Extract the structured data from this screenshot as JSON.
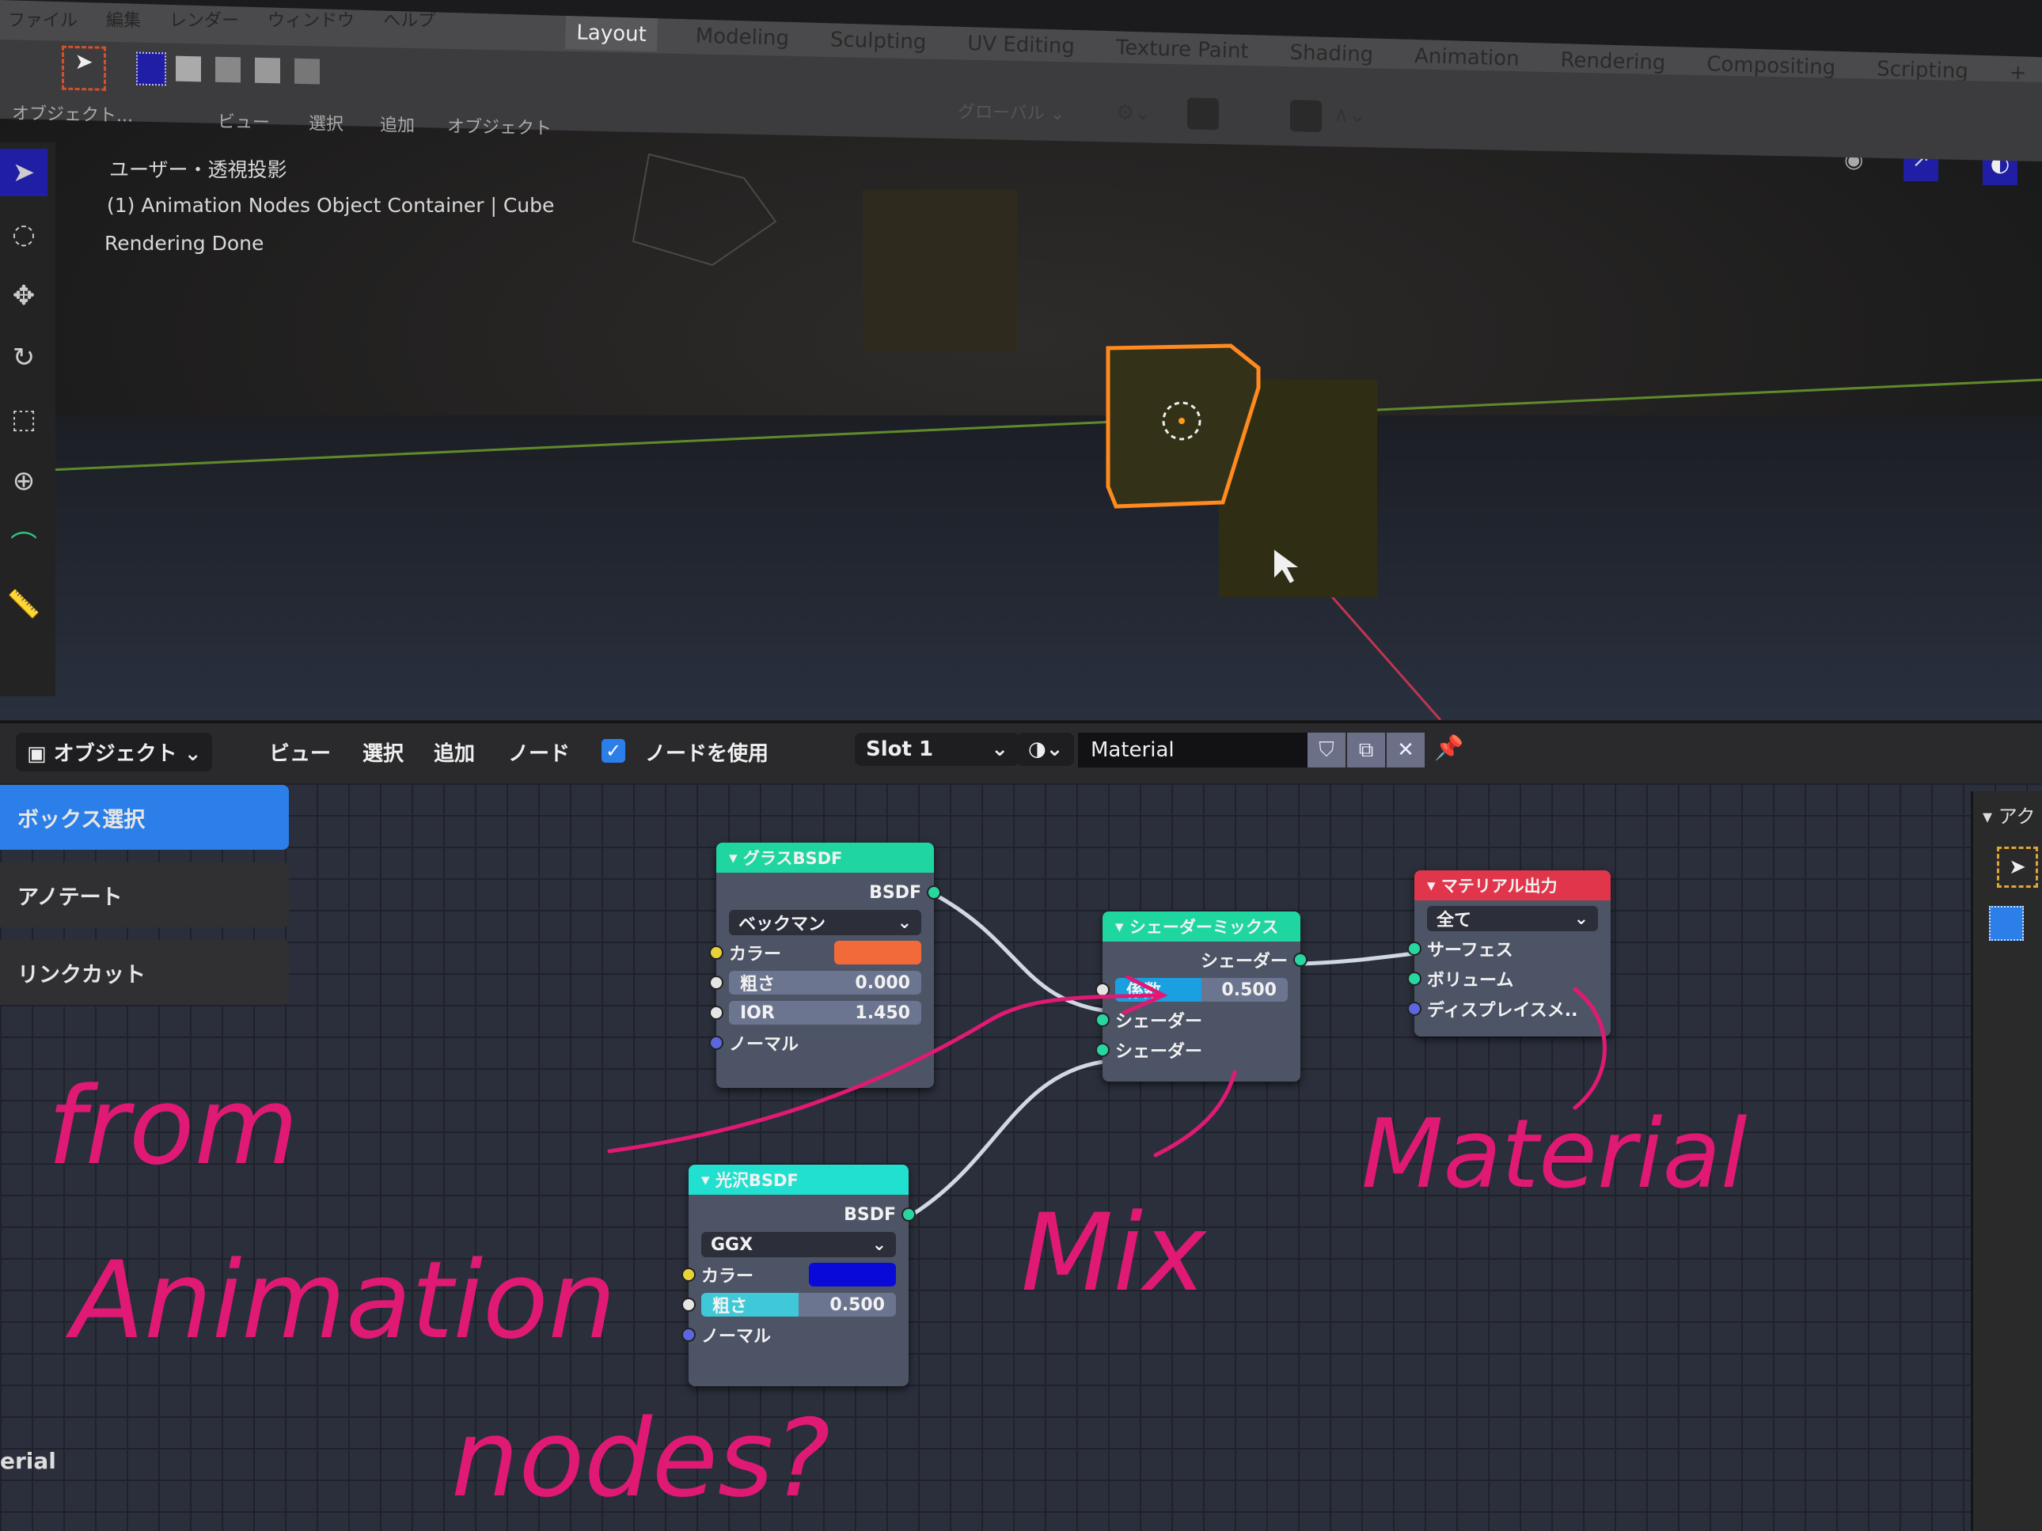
{
  "top_menu": [
    "ファイル",
    "編集",
    "レンダー",
    "ウィンドウ",
    "ヘルプ"
  ],
  "workspace_tabs": [
    {
      "label": "Layout",
      "active": true
    },
    {
      "label": "Modeling"
    },
    {
      "label": "Sculpting"
    },
    {
      "label": "UV Editing"
    },
    {
      "label": "Texture Paint"
    },
    {
      "label": "Shading"
    },
    {
      "label": "Animation"
    },
    {
      "label": "Rendering"
    },
    {
      "label": "Compositing"
    },
    {
      "label": "Scripting"
    },
    {
      "label": "+"
    }
  ],
  "viewport_header": {
    "mode": "オブジェクト...",
    "menus": [
      "ビュー",
      "選択",
      "追加",
      "オブジェクト"
    ],
    "transform_orientation": "グローバル"
  },
  "viewport_overlay": {
    "view_name": "ユーザー・透視投影",
    "object_info": "(1) Animation Nodes Object Container | Cube",
    "status": "Rendering Done"
  },
  "viewport_icons": [
    "view-object-icon",
    "gizmo-icon",
    "overlay-icon"
  ],
  "left_tools": [
    "select-box-icon",
    "cursor-icon",
    "move-icon",
    "rotate-icon",
    "scale-icon",
    "transform-icon",
    "annotate-icon",
    "measure-icon"
  ],
  "node_header": {
    "object_mode": "オブジェクト",
    "menus": [
      "ビュー",
      "選択",
      "追加",
      "ノード"
    ],
    "use_nodes_label": "ノードを使用",
    "use_nodes_checked": true,
    "slot": "Slot 1",
    "material_name": "Material"
  },
  "tool_panel": [
    {
      "label": "ボックス選択",
      "active": true
    },
    {
      "label": "アノテート",
      "active": false
    },
    {
      "label": "リンクカット",
      "active": false
    }
  ],
  "right_panel": {
    "title": "アク"
  },
  "footer_label": "erial",
  "nodes": {
    "glass": {
      "title": "グラスBSDF",
      "output": "BSDF",
      "distribution": "ベックマン",
      "color_label": "カラー",
      "color": "#f26a3a",
      "roughness_label": "粗さ",
      "roughness": "0.000",
      "ior_label": "IOR",
      "ior": "1.450",
      "normal_label": "ノーマル"
    },
    "mix": {
      "title": "シェーダーミックス",
      "output": "シェーダー",
      "fac_label": "係数",
      "fac": "0.500",
      "fac_fraction": 0.5,
      "input1": "シェーダー",
      "input2": "シェーダー"
    },
    "output": {
      "title": "マテリアル出力",
      "target": "全て",
      "surface": "サーフェス",
      "volume": "ボリューム",
      "displacement": "ディスプレイスメ.."
    },
    "glossy": {
      "title": "光沢BSDF",
      "output": "BSDF",
      "distribution": "GGX",
      "color_label": "カラー",
      "color": "#0a0ad8",
      "roughness_label": "粗さ",
      "roughness": "0.500",
      "normal_label": "ノーマル"
    }
  },
  "annotations": {
    "left": [
      "from",
      "Animation",
      "nodes?"
    ],
    "mix": "Mix",
    "material": "Material"
  },
  "colors": {
    "node_header_shader": "#1fd6a0",
    "node_header_output": "#e0354b",
    "active_blue": "#2c7ee8",
    "annotation": "#e01a74",
    "selection_orange": "#ff8a1f"
  }
}
